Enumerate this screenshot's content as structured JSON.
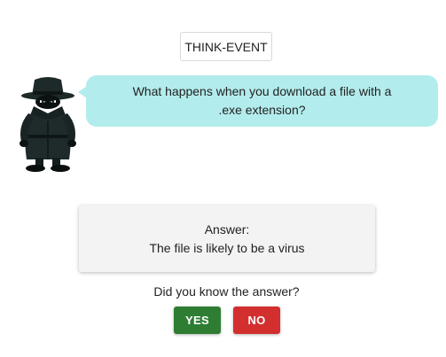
{
  "event": {
    "tag_label": "THINK-EVENT"
  },
  "character": {
    "icon": "spy-character-icon"
  },
  "question": {
    "text": "What happens when you download a file with a .exe extension?"
  },
  "answer": {
    "heading": "Answer:",
    "text": "The file is likely to be a virus"
  },
  "prompt": {
    "text": "Did you know the answer?"
  },
  "buttons": {
    "yes_label": "YES",
    "no_label": "NO"
  },
  "colors": {
    "bubble": "#b3ecec",
    "yes": "#2e7d32",
    "no": "#d32f2f",
    "card": "#f3f3f3"
  }
}
